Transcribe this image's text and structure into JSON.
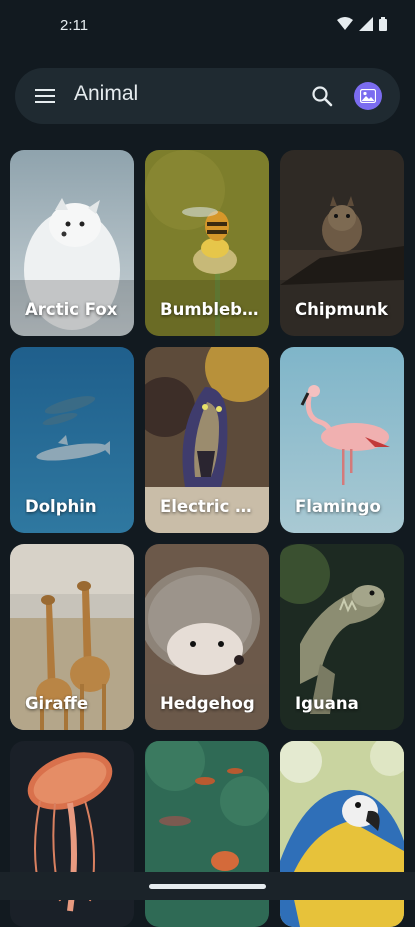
{
  "status_bar": {
    "time": "2:11"
  },
  "app_bar": {
    "title": "Animal"
  },
  "icons": {
    "menu": "menu-icon",
    "search": "search-icon",
    "avatar": "photo-avatar-icon"
  },
  "colors": {
    "background": "#121a20",
    "app_bar": "#1f2a31",
    "avatar": "#7b6cf0"
  },
  "grid": [
    {
      "label": "Arctic Fox"
    },
    {
      "label": "Bumbleb..."
    },
    {
      "label": "Chipmunk"
    },
    {
      "label": "Dolphin"
    },
    {
      "label": "Electric Eel"
    },
    {
      "label": "Flamingo"
    },
    {
      "label": "Giraffe"
    },
    {
      "label": "Hedgehog"
    },
    {
      "label": "Iguana"
    },
    {
      "label": ""
    },
    {
      "label": ""
    },
    {
      "label": ""
    }
  ]
}
